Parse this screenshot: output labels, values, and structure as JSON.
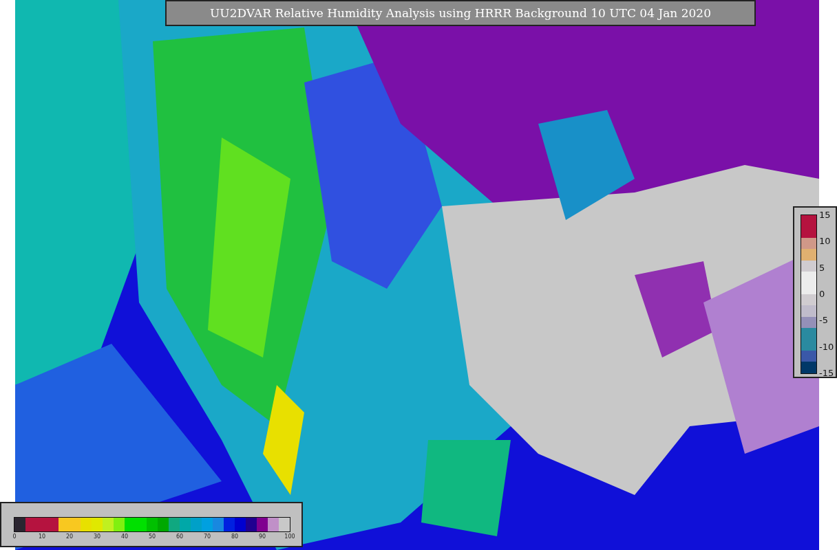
{
  "title": "UU2DVAR Relative Humidity Analysis using HRRR Background 10 UTC 04 Jan 2020",
  "colorbar_horizontal": {
    "ticks": [
      "0",
      "10",
      "20",
      "30",
      "40",
      "50",
      "60",
      "70",
      "80",
      "90",
      "100"
    ],
    "bands": [
      {
        "color": "#2b2530"
      },
      {
        "color": "#b5133f"
      },
      {
        "color": "#b5133f"
      },
      {
        "color": "#b5133f"
      },
      {
        "color": "#f8c820"
      },
      {
        "color": "#f8c820"
      },
      {
        "color": "#e8e000"
      },
      {
        "color": "#e0e800"
      },
      {
        "color": "#c0f020"
      },
      {
        "color": "#80f010"
      },
      {
        "color": "#00e000"
      },
      {
        "color": "#00e000"
      },
      {
        "color": "#00c000"
      },
      {
        "color": "#00a800"
      },
      {
        "color": "#10a880"
      },
      {
        "color": "#00a8a8"
      },
      {
        "color": "#00a0c8"
      },
      {
        "color": "#00a0e0"
      },
      {
        "color": "#1888e0"
      },
      {
        "color": "#0020e0"
      },
      {
        "color": "#0000d0"
      },
      {
        "color": "#200090"
      },
      {
        "color": "#800090"
      },
      {
        "color": "#c090c8"
      },
      {
        "color": "#c8c8c8"
      }
    ]
  },
  "colorbar_vertical": {
    "ticks": [
      "15",
      "10",
      "5",
      "0",
      "-5",
      "-10",
      "-15"
    ],
    "bands": [
      {
        "color": "#b5133f"
      },
      {
        "color": "#b5133f"
      },
      {
        "color": "#d09888"
      },
      {
        "color": "#e0b070"
      },
      {
        "color": "#d0ccd0"
      },
      {
        "color": "#ececec"
      },
      {
        "color": "#ececec"
      },
      {
        "color": "#d0ccd0"
      },
      {
        "color": "#c0bccb"
      },
      {
        "color": "#9490b8"
      },
      {
        "color": "#2a8aa0"
      },
      {
        "color": "#2a8aa0"
      },
      {
        "color": "#3a58a8"
      },
      {
        "color": "#003868"
      }
    ]
  }
}
